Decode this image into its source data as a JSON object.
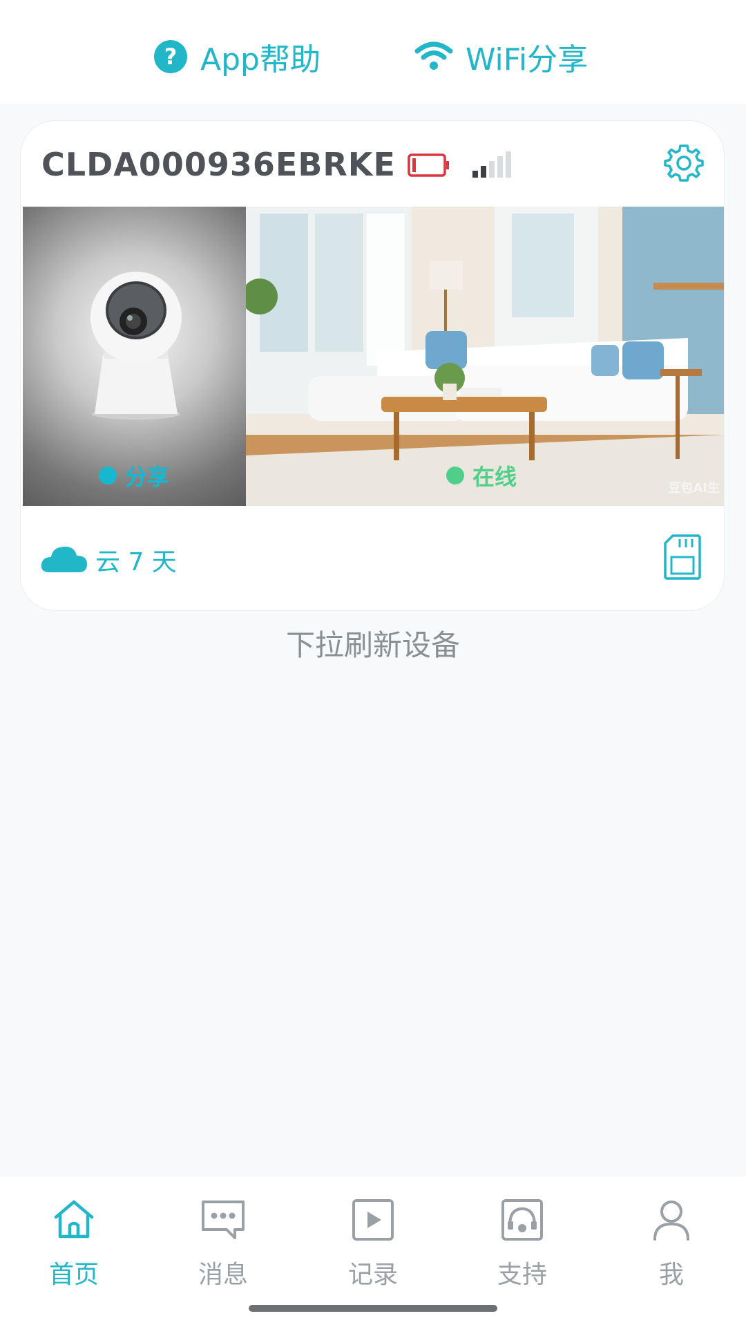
{
  "top_links": {
    "help_label": "App帮助",
    "wifi_label": "WiFi分享"
  },
  "device": {
    "name": "CLDA000936EBRKE",
    "battery_icon": "battery-low-icon",
    "signal_icon": "signal-weak-icon",
    "settings_icon": "gear-icon",
    "share_status": "分享",
    "online_status": "在线",
    "watermark": "豆包AI生",
    "cloud_label": "云 7 天",
    "sd_icon": "sd-card-icon"
  },
  "pull_hint": "下拉刷新设备",
  "tabs": [
    {
      "label": "首页",
      "icon": "home-icon",
      "active": true
    },
    {
      "label": "消息",
      "icon": "message-icon",
      "active": false
    },
    {
      "label": "记录",
      "icon": "play-record-icon",
      "active": false
    },
    {
      "label": "支持",
      "icon": "support-icon",
      "active": false
    },
    {
      "label": "我",
      "icon": "user-icon",
      "active": false
    }
  ],
  "colors": {
    "accent": "#21b6c8",
    "online": "#4fcf8a",
    "battery": "#d9363e",
    "inactive": "#9aa0a5"
  }
}
